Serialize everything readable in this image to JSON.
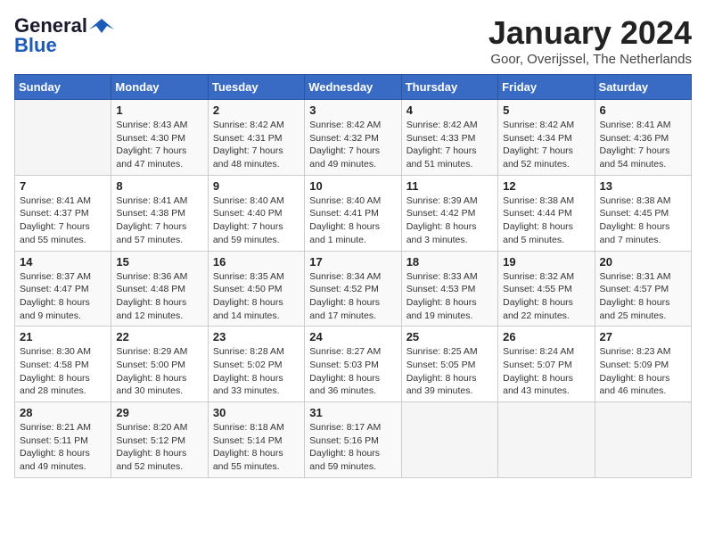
{
  "logo": {
    "line1": "General",
    "line2": "Blue"
  },
  "title": "January 2024",
  "location": "Goor, Overijssel, The Netherlands",
  "days_header": [
    "Sunday",
    "Monday",
    "Tuesday",
    "Wednesday",
    "Thursday",
    "Friday",
    "Saturday"
  ],
  "weeks": [
    [
      {
        "day": "",
        "content": ""
      },
      {
        "day": "1",
        "content": "Sunrise: 8:43 AM\nSunset: 4:30 PM\nDaylight: 7 hours\nand 47 minutes."
      },
      {
        "day": "2",
        "content": "Sunrise: 8:42 AM\nSunset: 4:31 PM\nDaylight: 7 hours\nand 48 minutes."
      },
      {
        "day": "3",
        "content": "Sunrise: 8:42 AM\nSunset: 4:32 PM\nDaylight: 7 hours\nand 49 minutes."
      },
      {
        "day": "4",
        "content": "Sunrise: 8:42 AM\nSunset: 4:33 PM\nDaylight: 7 hours\nand 51 minutes."
      },
      {
        "day": "5",
        "content": "Sunrise: 8:42 AM\nSunset: 4:34 PM\nDaylight: 7 hours\nand 52 minutes."
      },
      {
        "day": "6",
        "content": "Sunrise: 8:41 AM\nSunset: 4:36 PM\nDaylight: 7 hours\nand 54 minutes."
      }
    ],
    [
      {
        "day": "7",
        "content": "Sunrise: 8:41 AM\nSunset: 4:37 PM\nDaylight: 7 hours\nand 55 minutes."
      },
      {
        "day": "8",
        "content": "Sunrise: 8:41 AM\nSunset: 4:38 PM\nDaylight: 7 hours\nand 57 minutes."
      },
      {
        "day": "9",
        "content": "Sunrise: 8:40 AM\nSunset: 4:40 PM\nDaylight: 7 hours\nand 59 minutes."
      },
      {
        "day": "10",
        "content": "Sunrise: 8:40 AM\nSunset: 4:41 PM\nDaylight: 8 hours\nand 1 minute."
      },
      {
        "day": "11",
        "content": "Sunrise: 8:39 AM\nSunset: 4:42 PM\nDaylight: 8 hours\nand 3 minutes."
      },
      {
        "day": "12",
        "content": "Sunrise: 8:38 AM\nSunset: 4:44 PM\nDaylight: 8 hours\nand 5 minutes."
      },
      {
        "day": "13",
        "content": "Sunrise: 8:38 AM\nSunset: 4:45 PM\nDaylight: 8 hours\nand 7 minutes."
      }
    ],
    [
      {
        "day": "14",
        "content": "Sunrise: 8:37 AM\nSunset: 4:47 PM\nDaylight: 8 hours\nand 9 minutes."
      },
      {
        "day": "15",
        "content": "Sunrise: 8:36 AM\nSunset: 4:48 PM\nDaylight: 8 hours\nand 12 minutes."
      },
      {
        "day": "16",
        "content": "Sunrise: 8:35 AM\nSunset: 4:50 PM\nDaylight: 8 hours\nand 14 minutes."
      },
      {
        "day": "17",
        "content": "Sunrise: 8:34 AM\nSunset: 4:52 PM\nDaylight: 8 hours\nand 17 minutes."
      },
      {
        "day": "18",
        "content": "Sunrise: 8:33 AM\nSunset: 4:53 PM\nDaylight: 8 hours\nand 19 minutes."
      },
      {
        "day": "19",
        "content": "Sunrise: 8:32 AM\nSunset: 4:55 PM\nDaylight: 8 hours\nand 22 minutes."
      },
      {
        "day": "20",
        "content": "Sunrise: 8:31 AM\nSunset: 4:57 PM\nDaylight: 8 hours\nand 25 minutes."
      }
    ],
    [
      {
        "day": "21",
        "content": "Sunrise: 8:30 AM\nSunset: 4:58 PM\nDaylight: 8 hours\nand 28 minutes."
      },
      {
        "day": "22",
        "content": "Sunrise: 8:29 AM\nSunset: 5:00 PM\nDaylight: 8 hours\nand 30 minutes."
      },
      {
        "day": "23",
        "content": "Sunrise: 8:28 AM\nSunset: 5:02 PM\nDaylight: 8 hours\nand 33 minutes."
      },
      {
        "day": "24",
        "content": "Sunrise: 8:27 AM\nSunset: 5:03 PM\nDaylight: 8 hours\nand 36 minutes."
      },
      {
        "day": "25",
        "content": "Sunrise: 8:25 AM\nSunset: 5:05 PM\nDaylight: 8 hours\nand 39 minutes."
      },
      {
        "day": "26",
        "content": "Sunrise: 8:24 AM\nSunset: 5:07 PM\nDaylight: 8 hours\nand 43 minutes."
      },
      {
        "day": "27",
        "content": "Sunrise: 8:23 AM\nSunset: 5:09 PM\nDaylight: 8 hours\nand 46 minutes."
      }
    ],
    [
      {
        "day": "28",
        "content": "Sunrise: 8:21 AM\nSunset: 5:11 PM\nDaylight: 8 hours\nand 49 minutes."
      },
      {
        "day": "29",
        "content": "Sunrise: 8:20 AM\nSunset: 5:12 PM\nDaylight: 8 hours\nand 52 minutes."
      },
      {
        "day": "30",
        "content": "Sunrise: 8:18 AM\nSunset: 5:14 PM\nDaylight: 8 hours\nand 55 minutes."
      },
      {
        "day": "31",
        "content": "Sunrise: 8:17 AM\nSunset: 5:16 PM\nDaylight: 8 hours\nand 59 minutes."
      },
      {
        "day": "",
        "content": ""
      },
      {
        "day": "",
        "content": ""
      },
      {
        "day": "",
        "content": ""
      }
    ]
  ]
}
